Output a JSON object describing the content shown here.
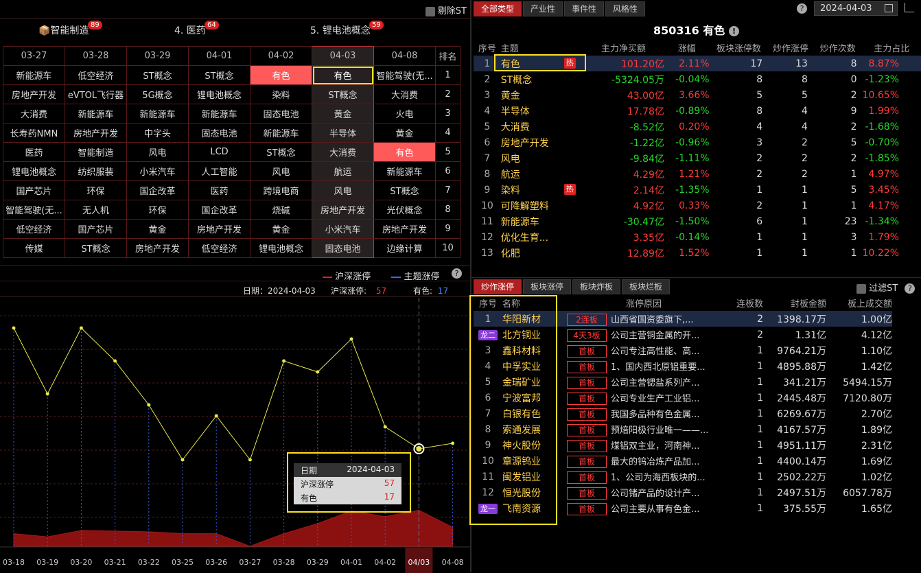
{
  "left_top": {
    "exclude_st": "剔除ST"
  },
  "themes": [
    {
      "label": "📦智能制造",
      "badge": "89"
    },
    {
      "label": "4. 医药",
      "badge": "64"
    },
    {
      "label": "5. 锂电池概念",
      "badge": "59"
    }
  ],
  "grid": {
    "headers": [
      "03-27",
      "03-28",
      "03-29",
      "04-01",
      "04-02",
      "04-03",
      "04-08",
      "排名"
    ],
    "rows": [
      [
        "新能源车",
        "低空经济",
        "ST概念",
        "ST概念",
        "有色",
        "有色",
        "智能驾驶(无...",
        "1"
      ],
      [
        "房地产开发",
        "eVTOL飞行器",
        "5G概念",
        "锂电池概念",
        "染料",
        "ST概念",
        "大消费",
        "2"
      ],
      [
        "大消费",
        "新能源车",
        "新能源车",
        "新能源车",
        "固态电池",
        "黄金",
        "火电",
        "3"
      ],
      [
        "长寿药NMN",
        "房地产开发",
        "中字头",
        "固态电池",
        "新能源车",
        "半导体",
        "黄金",
        "4"
      ],
      [
        "医药",
        "智能制造",
        "风电",
        "LCD",
        "ST概念",
        "大消费",
        "有色",
        "5"
      ],
      [
        "锂电池概念",
        "纺织服装",
        "小米汽车",
        "人工智能",
        "风电",
        "航运",
        "新能源车",
        "6"
      ],
      [
        "国产芯片",
        "环保",
        "国企改革",
        "医药",
        "跨境电商",
        "风电",
        "ST概念",
        "7"
      ],
      [
        "智能驾驶(无...",
        "无人机",
        "环保",
        "国企改革",
        "烧碱",
        "房地产开发",
        "光伏概念",
        "8"
      ],
      [
        "低空经济",
        "国产芯片",
        "黄金",
        "房地产开发",
        "黄金",
        "小米汽车",
        "房地产开发",
        "9"
      ],
      [
        "传媒",
        "ST概念",
        "房地产开发",
        "低空经济",
        "锂电池概念",
        "固态电池",
        "边缘计算",
        "10"
      ]
    ]
  },
  "chart": {
    "legend_red": "沪深涨停",
    "legend_blue": "主题涨停",
    "info_date_label": "日期：",
    "info_date": "2024-04-03",
    "info_hs_label": "沪深涨停:",
    "info_hs": "57",
    "info_theme_label": "有色:",
    "info_theme": "17",
    "tooltip": {
      "date_label": "日期",
      "date": "2024-04-03",
      "hs_label": "沪深涨停",
      "hs": "57",
      "theme_label": "有色",
      "theme": "17"
    }
  },
  "chart_data": {
    "type": "line",
    "x": [
      "03-18",
      "03-19",
      "03-20",
      "03-21",
      "03-22",
      "03-25",
      "03-26",
      "03-27",
      "03-28",
      "03-29",
      "04-01",
      "04-02",
      "04/03",
      "04-08"
    ],
    "series": [
      {
        "name": "主题涨停",
        "values": [
          21,
          15,
          21,
          18,
          14,
          9,
          13,
          9,
          18,
          17,
          20,
          12,
          10,
          10.5
        ]
      },
      {
        "name": "沪深涨停",
        "values": [
          20,
          15,
          25,
          24,
          23,
          20,
          20,
          0,
          20,
          36,
          56,
          47,
          57,
          30
        ]
      }
    ],
    "colors": {
      "line": "#e8e84a",
      "area": "#8b1010",
      "grid": "#5a1a1a",
      "vline": "#3a5ad8"
    }
  },
  "right_top": {
    "tabs": [
      "全部类型",
      "产业性",
      "事件性",
      "风格性"
    ],
    "date": "2024-04-03",
    "title": "850316 有色",
    "headers": [
      "序号",
      "主题",
      "主力净买额",
      "涨幅",
      "板块涨停数",
      "炒作涨停",
      "炒作次数",
      "主力占比"
    ],
    "rows": [
      {
        "n": "1",
        "name": "有色",
        "hot": "热",
        "amt": "101.20亿",
        "pct": "2.11%",
        "z": "17",
        "c": "13",
        "t": "8",
        "r": "8.87%",
        "ac": "red",
        "pc": "red",
        "rc": "red"
      },
      {
        "n": "2",
        "name": "ST概念",
        "hot": "",
        "amt": "-5324.05万",
        "pct": "-0.04%",
        "z": "8",
        "c": "8",
        "t": "0",
        "r": "-1.23%",
        "ac": "green",
        "pc": "green",
        "rc": "green"
      },
      {
        "n": "3",
        "name": "黄金",
        "hot": "",
        "amt": "43.00亿",
        "pct": "3.66%",
        "z": "5",
        "c": "5",
        "t": "2",
        "r": "10.65%",
        "ac": "red",
        "pc": "red",
        "rc": "red"
      },
      {
        "n": "4",
        "name": "半导体",
        "hot": "",
        "amt": "17.78亿",
        "pct": "-0.89%",
        "z": "8",
        "c": "4",
        "t": "9",
        "r": "1.99%",
        "ac": "red",
        "pc": "green",
        "rc": "red"
      },
      {
        "n": "5",
        "name": "大消费",
        "hot": "",
        "amt": "-8.52亿",
        "pct": "0.20%",
        "z": "4",
        "c": "4",
        "t": "2",
        "r": "-1.68%",
        "ac": "green",
        "pc": "red",
        "rc": "green"
      },
      {
        "n": "6",
        "name": "房地产开发",
        "hot": "",
        "amt": "-1.22亿",
        "pct": "-0.96%",
        "z": "3",
        "c": "2",
        "t": "5",
        "r": "-0.70%",
        "ac": "green",
        "pc": "green",
        "rc": "green"
      },
      {
        "n": "7",
        "name": "风电",
        "hot": "",
        "amt": "-9.84亿",
        "pct": "-1.11%",
        "z": "2",
        "c": "2",
        "t": "2",
        "r": "-1.85%",
        "ac": "green",
        "pc": "green",
        "rc": "green"
      },
      {
        "n": "8",
        "name": "航运",
        "hot": "",
        "amt": "4.29亿",
        "pct": "1.21%",
        "z": "2",
        "c": "2",
        "t": "1",
        "r": "4.97%",
        "ac": "red",
        "pc": "red",
        "rc": "red"
      },
      {
        "n": "9",
        "name": "染料",
        "hot": "热",
        "amt": "2.14亿",
        "pct": "-1.35%",
        "z": "1",
        "c": "1",
        "t": "5",
        "r": "3.45%",
        "ac": "red",
        "pc": "green",
        "rc": "red"
      },
      {
        "n": "10",
        "name": "可降解塑料",
        "hot": "",
        "amt": "4.92亿",
        "pct": "0.33%",
        "z": "2",
        "c": "1",
        "t": "1",
        "r": "4.17%",
        "ac": "red",
        "pc": "red",
        "rc": "red"
      },
      {
        "n": "11",
        "name": "新能源车",
        "hot": "",
        "amt": "-30.47亿",
        "pct": "-1.50%",
        "z": "6",
        "c": "1",
        "t": "23",
        "r": "-1.34%",
        "ac": "green",
        "pc": "green",
        "rc": "green"
      },
      {
        "n": "12",
        "name": "优化生育...",
        "hot": "",
        "amt": "3.35亿",
        "pct": "-0.14%",
        "z": "1",
        "c": "1",
        "t": "3",
        "r": "1.79%",
        "ac": "red",
        "pc": "green",
        "rc": "red"
      },
      {
        "n": "13",
        "name": "化肥",
        "hot": "",
        "amt": "12.89亿",
        "pct": "1.52%",
        "z": "1",
        "c": "1",
        "t": "1",
        "r": "10.22%",
        "ac": "red",
        "pc": "red",
        "rc": "red"
      }
    ]
  },
  "right_bottom": {
    "tabs": [
      "炒作涨停",
      "板块涨停",
      "板块炸板",
      "板块烂板"
    ],
    "filter_st": "过滤ST",
    "headers": [
      "序号",
      "名称",
      "涨停原因",
      "连板数",
      "封板金额",
      "板上成交额"
    ],
    "rows": [
      {
        "n": "1",
        "long": "",
        "name": "华阳新材",
        "tag": "2连板",
        "reason": "山西省国资委旗下,...",
        "lb": "2",
        "amt": "1398.17万",
        "vol": "1.00亿"
      },
      {
        "n": "",
        "long": "龙二",
        "name": "北方铜业",
        "tag": "4天3板",
        "reason": "公司主营铜金属的开...",
        "lb": "2",
        "amt": "1.31亿",
        "vol": "4.12亿"
      },
      {
        "n": "3",
        "long": "",
        "name": "鑫科材料",
        "tag": "首板",
        "reason": "公司专注高性能、高...",
        "lb": "1",
        "amt": "9764.21万",
        "vol": "1.10亿"
      },
      {
        "n": "4",
        "long": "",
        "name": "中孚实业",
        "tag": "首板",
        "reason": "1、国内西北原铝重要...",
        "lb": "1",
        "amt": "4895.88万",
        "vol": "1.42亿"
      },
      {
        "n": "5",
        "long": "",
        "name": "金瑞矿业",
        "tag": "首板",
        "reason": "公司主营锶盐系列产...",
        "lb": "1",
        "amt": "341.21万",
        "vol": "5494.15万"
      },
      {
        "n": "6",
        "long": "",
        "name": "宁波富邦",
        "tag": "首板",
        "reason": "公司专业生产工业铝...",
        "lb": "1",
        "amt": "2445.48万",
        "vol": "7120.80万"
      },
      {
        "n": "7",
        "long": "",
        "name": "白银有色",
        "tag": "首板",
        "reason": "我国多品种有色金属...",
        "lb": "1",
        "amt": "6269.67万",
        "vol": "2.70亿"
      },
      {
        "n": "8",
        "long": "",
        "name": "索通发展",
        "tag": "首板",
        "reason": "预焙阳极行业唯一——...",
        "lb": "1",
        "amt": "4167.57万",
        "vol": "1.89亿"
      },
      {
        "n": "9",
        "long": "",
        "name": "神火股份",
        "tag": "首板",
        "reason": "煤铝双主业，河南神...",
        "lb": "1",
        "amt": "4951.11万",
        "vol": "2.31亿"
      },
      {
        "n": "10",
        "long": "",
        "name": "章源钨业",
        "tag": "首板",
        "reason": "最大的钨冶炼产品加...",
        "lb": "1",
        "amt": "4400.14万",
        "vol": "1.69亿"
      },
      {
        "n": "11",
        "long": "",
        "name": "闽发铝业",
        "tag": "首板",
        "reason": "1、公司为海西板块的...",
        "lb": "1",
        "amt": "2502.22万",
        "vol": "1.02亿"
      },
      {
        "n": "12",
        "long": "",
        "name": "恒光股份",
        "tag": "首板",
        "reason": "公司锗产品的设计产...",
        "lb": "1",
        "amt": "2497.51万",
        "vol": "6057.78万"
      },
      {
        "n": "",
        "long": "龙一",
        "name": "飞南资源",
        "tag": "首板",
        "reason": "公司主要从事有色金...",
        "lb": "1",
        "amt": "375.55万",
        "vol": "1.65亿"
      }
    ]
  }
}
